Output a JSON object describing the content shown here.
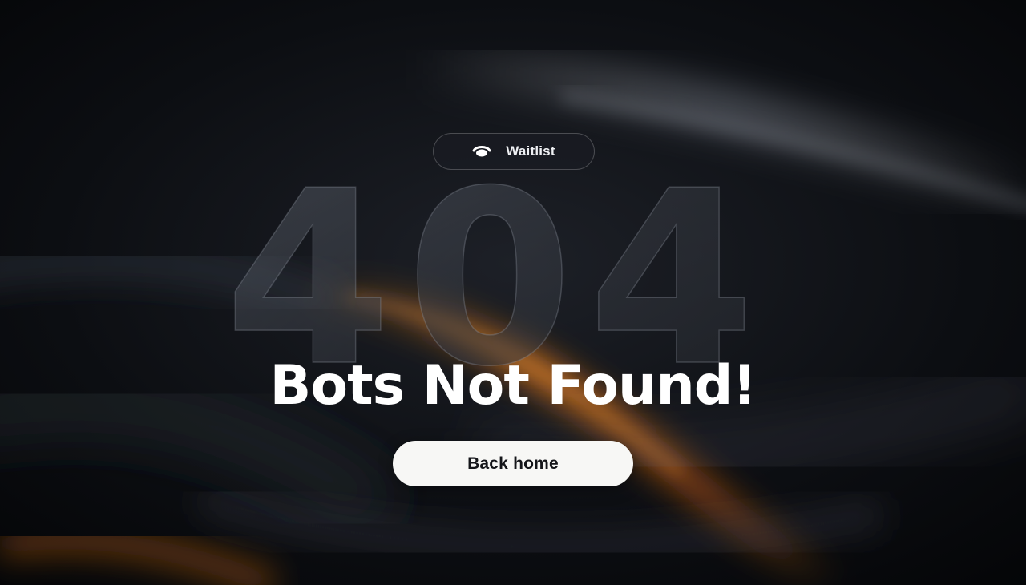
{
  "waitlist": {
    "label": "Waitlist",
    "icon": "waitlist-icon"
  },
  "error": {
    "code": "404",
    "headline": "Bots Not Found!"
  },
  "actions": {
    "back_home_label": "Back home"
  },
  "colors": {
    "background": "#06070a",
    "accent_glow": "#e07a1f",
    "button_bg": "#f7f7f5",
    "button_text": "#15161a",
    "headline": "#ffffff"
  }
}
